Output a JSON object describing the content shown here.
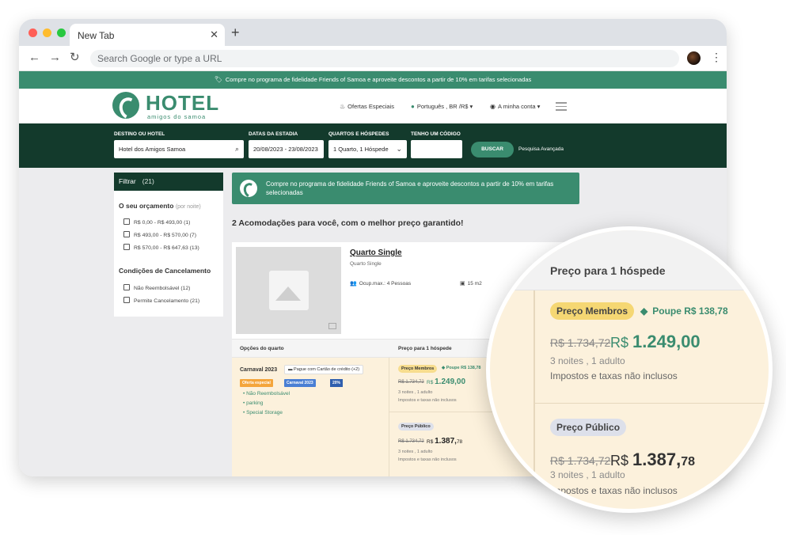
{
  "browser": {
    "tab_title": "New Tab",
    "tab_close": "✕",
    "new_tab": "+",
    "omnibox_placeholder": "Search Google or type a URL",
    "back": "←",
    "forward": "→",
    "reload": "↻",
    "menu": "⋮"
  },
  "site": {
    "promo_bar": "Compre no programa de fidelidade Friends of Samoa e aproveite descontos a partir de 10% em tarifas selecionadas",
    "logo_text": "HOTEL",
    "logo_sub": "amigos do samoa",
    "nav": {
      "offers": "Ofertas Especiais",
      "language": "Português , BR /R$",
      "account": "A minha conta"
    }
  },
  "search": {
    "destination_label": "DESTINO OU HOTEL",
    "destination_value": "Hotel dos Amigos Samoa",
    "dates_label": "DATAS DA ESTADIA",
    "dates_value": "20/08/2023 - 23/08/2023",
    "rooms_label": "QUARTOS E HÓSPEDES",
    "rooms_value": "1 Quarto, 1 Hóspede",
    "code_label": "TENHO UM CÓDIGO",
    "code_value": "",
    "search_button": "BUSCAR",
    "advanced": "Pesquisa Avançada"
  },
  "filters": {
    "title": "Filtrar",
    "count": "(21)",
    "budget_title": "O seu orçamento",
    "budget_hint": "(por noite)",
    "budget": [
      "R$ 0,00 - R$ 493,00 (1)",
      "R$ 493,00 - R$ 570,00 (7)",
      "R$ 570,00 - R$ 647,63 (13)"
    ],
    "cancel_title": "Condições de Cancelamento",
    "cancel": [
      "Não Reembolsável (12)",
      "Permite Cancelamento (21)"
    ]
  },
  "main": {
    "promo_text": "Compre no programa de fidelidade Friends of Samoa e aproveite descontos a partir de 10% em tarifas selecionadas",
    "results_title": "2 Acomodações para você, com o melhor preço garantido!",
    "room": {
      "name": "Quarto Single",
      "subtitle": "Quarto Single",
      "occupancy": "Ocup.max.: 4 Pessoas",
      "size": "15 m2"
    },
    "options_header": "Opções do quarto",
    "price_header": "Preço para 1 hóspede",
    "rate": {
      "name": "Carnaval 2023",
      "card_badge": "Pague com Cartão de crédito (+2)",
      "offer_badge": "Oferta especial",
      "carnaval_badge": "Carnaval 2023",
      "pct_badge": "20%",
      "features": [
        "Não Reembolsável",
        "parking",
        "Special Storage"
      ]
    },
    "members": {
      "label": "Preço Membros",
      "save": "Poupe R$ 138,78",
      "old_price": "R$ 1.734,72",
      "currency": "R$",
      "price": "1.249,00",
      "nights": "3 noites , 1 adulto",
      "taxes": "Impostos e taxas não inclusos"
    },
    "public": {
      "label": "Preço Público",
      "old_price": "R$ 1.734,72",
      "currency": "R$",
      "price_int": "1.387,",
      "price_cents": "78",
      "nights": "3 noites , 1 adulto",
      "taxes": "Impostos e taxas não inclusos"
    }
  },
  "zoom": {
    "header": "Preço para 1 hóspede",
    "members_label": "Preço Membros",
    "save": "Poupe R$ 138,78",
    "old_price": "R$ 1.734,72",
    "currency": "R$",
    "price": "1.249,00",
    "nights": "3 noites , 1 adulto",
    "taxes": "Impostos e taxas não inclusos",
    "public_label": "Preço Público",
    "old_price_public": "R$ 1.734,72",
    "currency_public": "R$",
    "price_public_int": "1.387,",
    "price_public_cents": "78",
    "nights_public": "3 noites , 1 adulto",
    "taxes_public": "Impostos e taxas não inclusos"
  },
  "colors": {
    "brand_green": "#3a8c6f",
    "dark_green": "#133a2c",
    "rate_bg": "#fcf1dc",
    "members_pill": "#f7dd8e"
  }
}
